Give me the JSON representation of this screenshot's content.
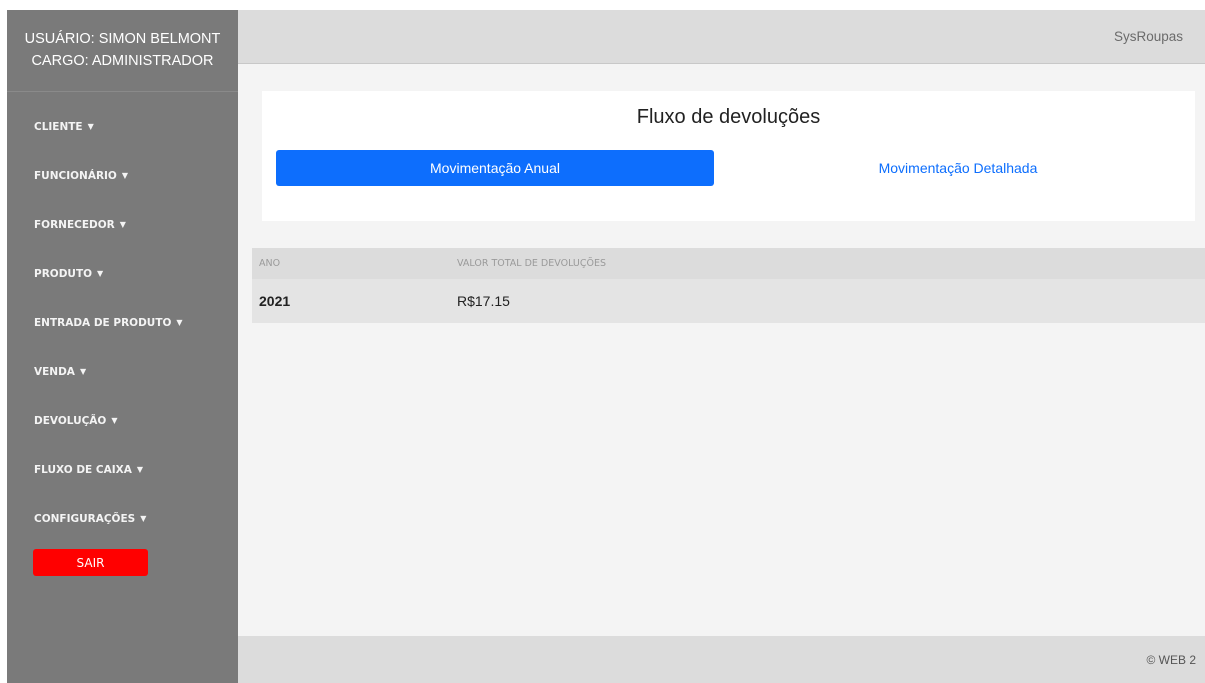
{
  "sidebar": {
    "user_line": "USUÁRIO: SIMON BELMONT",
    "role_line": "CARGO: ADMINISTRADOR",
    "menu": [
      {
        "label": "CLIENTE"
      },
      {
        "label": "FUNCIONÁRIO"
      },
      {
        "label": "FORNECEDOR"
      },
      {
        "label": "PRODUTO"
      },
      {
        "label": "ENTRADA DE PRODUTO"
      },
      {
        "label": "VENDA"
      },
      {
        "label": "DEVOLUÇÃO"
      },
      {
        "label": "FLUXO DE CAIXA"
      },
      {
        "label": "CONFIGURAÇÕES"
      }
    ],
    "logout_label": "SAIR"
  },
  "header": {
    "brand": "SysRoupas"
  },
  "card": {
    "title": "Fluxo de devoluções",
    "tabs": [
      {
        "label": "Movimentação Anual",
        "active": true
      },
      {
        "label": "Movimentação Detalhada",
        "active": false
      }
    ]
  },
  "table": {
    "headers": [
      "ANO",
      "VALOR TOTAL DE DEVOLUÇÕES"
    ],
    "rows": [
      [
        "2021",
        "R$17.15"
      ]
    ]
  },
  "footer": {
    "text": "© WEB 2"
  },
  "colors": {
    "sidebar_bg": "#7a7a7a",
    "primary": "#0d6efd",
    "logout": "#ff0000"
  },
  "icons": {
    "dropdown_caret": "caret-down-icon"
  }
}
